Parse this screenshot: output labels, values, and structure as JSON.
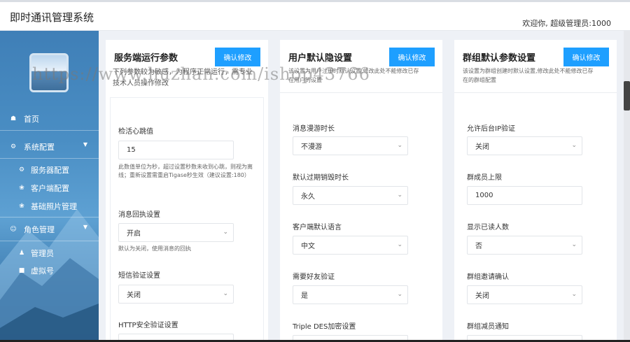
{
  "header": {
    "app_title": "即时通讯管理系统",
    "welcome": "欢迎你, 超级管理员:1000"
  },
  "sidebar": {
    "items": [
      {
        "label": "首页",
        "icon": "home-icon"
      },
      {
        "label": "系统配置",
        "icon": "gear-icon",
        "expanded": true
      },
      {
        "label": "服务器配置",
        "icon": "server-gears-icon"
      },
      {
        "label": "客户端配置",
        "icon": "client-config-icon"
      },
      {
        "label": "基础照片管理",
        "icon": "photo-config-icon"
      },
      {
        "label": "角色管理",
        "icon": "user-role-icon",
        "expanded": true
      },
      {
        "label": "管理员",
        "icon": "admin-user-icon"
      },
      {
        "label": "虚拟号",
        "icon": "lock-icon"
      }
    ]
  },
  "panels": [
    {
      "title": "服务端运行参数",
      "button": "确认修改",
      "description": "下列参数较为敏感，为程序正常运行，需专业技术人员操作修改",
      "fields": [
        {
          "label": "检活心跳值",
          "type": "input",
          "value": "15",
          "hint": "此数值单位为秒，超过设置秒数未收到心跳，则视为离线；重新设置需重启Tigase秒生效（建议设置:180）"
        },
        {
          "label": "消息回执设置",
          "type": "select",
          "value": "开启",
          "hint": "默认为关闭，使用消息的回执"
        },
        {
          "label": "短信验证设置",
          "type": "select",
          "value": "关闭"
        },
        {
          "label": "HTTP安全验证设置",
          "type": "select",
          "value": ""
        }
      ]
    },
    {
      "title": "用户默认隐设置",
      "button": "确认修改",
      "description": "该设置为用户注册时默认设置,修改此处不能修改已存在用户的设置",
      "fields": [
        {
          "label": "消息漫游时长",
          "type": "select",
          "value": "不漫游"
        },
        {
          "label": "默认过期销毁时长",
          "type": "select",
          "value": "永久"
        },
        {
          "label": "客户端默认语言",
          "type": "select",
          "value": "中文"
        },
        {
          "label": "需要好友验证",
          "type": "select",
          "value": "是"
        },
        {
          "label": "Triple DES加密设置",
          "type": "select",
          "value": ""
        }
      ]
    },
    {
      "title": "群组默认参数设置",
      "button": "确认修改",
      "description": "该设置为群组创建时默认设置,修改此处不能修改已存在的群组配置",
      "fields": [
        {
          "label": "允许后台IP验证",
          "type": "select",
          "value": "关闭"
        },
        {
          "label": "群成员上限",
          "type": "input",
          "value": "1000"
        },
        {
          "label": "显示已读人数",
          "type": "select",
          "value": "否"
        },
        {
          "label": "群组邀请确认",
          "type": "select",
          "value": "关闭"
        },
        {
          "label": "群组减员通知",
          "type": "select",
          "value": ""
        }
      ]
    }
  ],
  "watermark": "https://www.huzhan.com/ishop43766"
}
